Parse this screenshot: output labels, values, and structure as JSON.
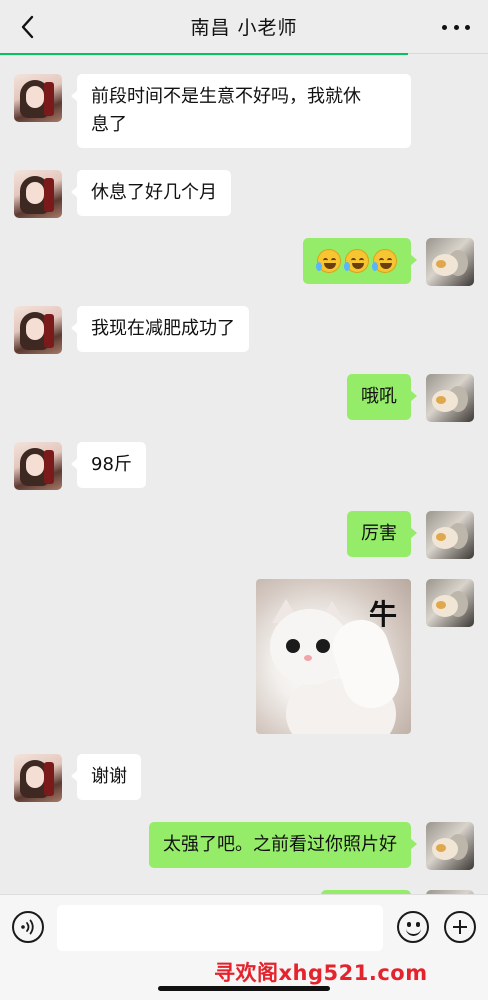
{
  "header": {
    "title": "南昌 小老师"
  },
  "messages": [
    {
      "side": "left",
      "text": "前段时间不是生意不好吗，我就休息了"
    },
    {
      "side": "left",
      "text": "休息了好几个月"
    },
    {
      "side": "right",
      "type": "emoji",
      "emoji": "rolling-on-floor-laughing-icon",
      "count": 3
    },
    {
      "side": "left",
      "text": "我现在减肥成功了"
    },
    {
      "side": "right",
      "text": "哦吼"
    },
    {
      "side": "left",
      "text": "98斤"
    },
    {
      "side": "right",
      "text": "厉害"
    },
    {
      "side": "right",
      "type": "sticker",
      "caption": "牛"
    },
    {
      "side": "left",
      "text": "谢谢"
    },
    {
      "side": "right",
      "text": "太强了吧。之前看过你照片好"
    }
  ],
  "message_line_1": "前段时间不是生意不好吗，我就休",
  "message_line_2": "息了",
  "input": {
    "value": "",
    "placeholder": ""
  },
  "icons": {
    "back": "chevron-left-icon",
    "more": "more-dots-icon",
    "voice": "voice-icon",
    "emoji": "emoji-icon",
    "plus": "plus-icon"
  },
  "watermark": "寻欢阁xhg521.com",
  "colors": {
    "outgoing_bubble": "#95ec69",
    "incoming_bubble": "#ffffff",
    "background": "#ececec",
    "watermark": "#e4232c"
  }
}
